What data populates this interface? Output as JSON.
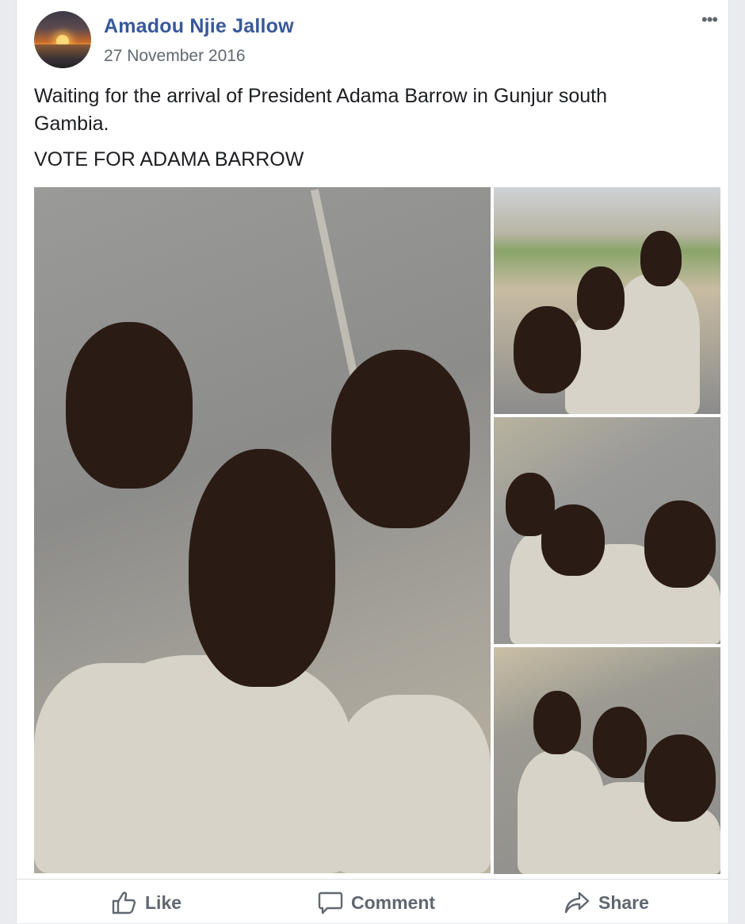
{
  "post": {
    "author": "Amadou Njie Jallow",
    "date": "27 November 2016",
    "text_line1": "Waiting for the arrival of President Adama Barrow in Gunjur south Gambia.",
    "text_line2": "VOTE FOR ADAMA BARROW",
    "more_label": "•••"
  },
  "actions": {
    "like": "Like",
    "comment": "Comment",
    "share": "Share"
  }
}
